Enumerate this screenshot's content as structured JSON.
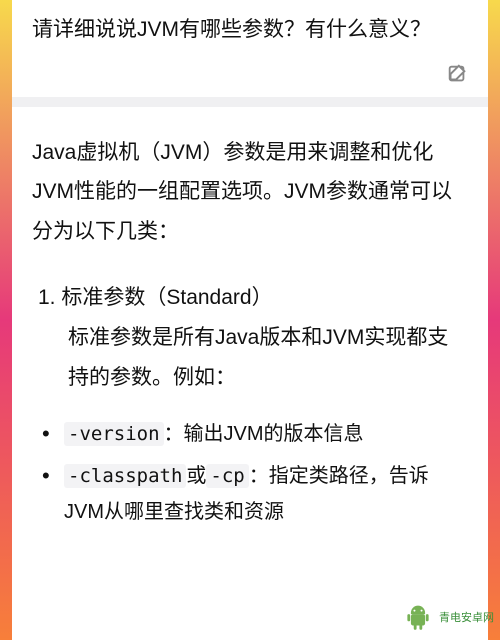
{
  "question": {
    "text": "请详细说说JVM有哪些参数？有什么意义？"
  },
  "answer": {
    "intro": "Java虚拟机（JVM）参数是用来调整和优化JVM性能的一组配置选项。JVM参数通常可以分为以下几类：",
    "sections": [
      {
        "number": "1.",
        "title": "标准参数（Standard）",
        "desc": "标准参数是所有Java版本和JVM实现都支持的参数。例如：",
        "bullets": [
          {
            "code": "-version",
            "rest": "：输出JVM的版本信息"
          },
          {
            "code": "-classpath",
            "mid": "或",
            "code2": "-cp",
            "rest": "：指定类路径，告诉JVM从哪里查找类和资源"
          }
        ]
      }
    ]
  },
  "watermark": {
    "text": "青电安卓网"
  }
}
